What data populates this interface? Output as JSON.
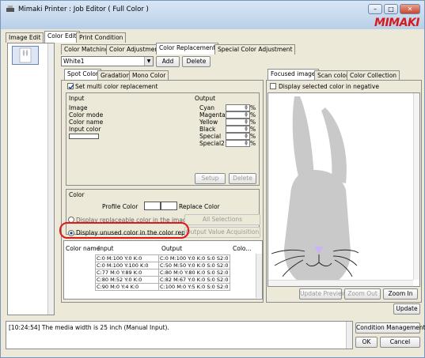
{
  "window": {
    "title": "Mimaki Printer : Job Editor ( Full Color )",
    "logo": "MIMAKI",
    "min": "–",
    "max": "□",
    "close": "✕"
  },
  "main_tabs": [
    "Image Edit",
    "Color Edit",
    "Print Condition"
  ],
  "sub_tabs": [
    "Color Matching",
    "Color Adjustment",
    "Color Replacement",
    "Special Color Adjustment"
  ],
  "toolbar": {
    "selected": "White1",
    "add": "Add",
    "delete": "Delete"
  },
  "inner_tabs": [
    "Spot Color",
    "Gradation",
    "Mono Color"
  ],
  "multi_label": "Set multi color replacement",
  "input": {
    "header": "Input",
    "items": [
      "Image",
      "Color mode",
      "Color name",
      "Input color"
    ]
  },
  "output": {
    "header": "Output",
    "channels": [
      "Cyan",
      "Magenta",
      "Yellow",
      "Black",
      "Special",
      "Special2"
    ],
    "unit": "%"
  },
  "setup": "Setup",
  "delete2": "Delete",
  "color_group": {
    "title": "Color",
    "profile": "Profile Color",
    "replace": "Replace Color"
  },
  "radio1": "Display replaceable color in the image",
  "radio2": "Display unused color in the color replac...",
  "all_sel": "All Selections",
  "out_acq": "Output Value Acquisition",
  "table": {
    "headers": [
      "Color name",
      "Input",
      "Output",
      "Colo..."
    ],
    "rows": [
      [
        "C:0 M:100 Y:0 K:0",
        "C:0 M:100 Y:0 K:0 S:0 S2:0"
      ],
      [
        "C:0 M:100 Y:100 K:0",
        "C:50 M:50 Y:0 K:0 S:0 S2:0"
      ],
      [
        "C:77 M:0 Y:89 K:0",
        "C:80 M:0 Y:80 K:0 S:0 S2:0"
      ],
      [
        "C:80 M:52 Y:0 K:0",
        "C:82 M:67 Y:0 K:0 S:0 S2:0"
      ],
      [
        "C:90 M:0 Y:4 K:0",
        "C:100 M:0 Y:5 K:0 S:0 S2:0"
      ]
    ]
  },
  "right_tabs": [
    "Focused image",
    "Scan color",
    "Color Collection"
  ],
  "negative": "Display selected color in negative",
  "preview_btns": {
    "update_preview": "Update Preview",
    "zoom_out": "Zoom Out",
    "zoom_in": "Zoom In"
  },
  "update": "Update",
  "log": "[10:24:54] The media width is 25 inch (Manual Input).",
  "condition": "Condition Management",
  "ok": "OK",
  "cancel": "Cancel",
  "colors": {
    "highlight": "#e01818",
    "rabbit": "#c9c9c9",
    "nose": "#c8b6f0"
  }
}
